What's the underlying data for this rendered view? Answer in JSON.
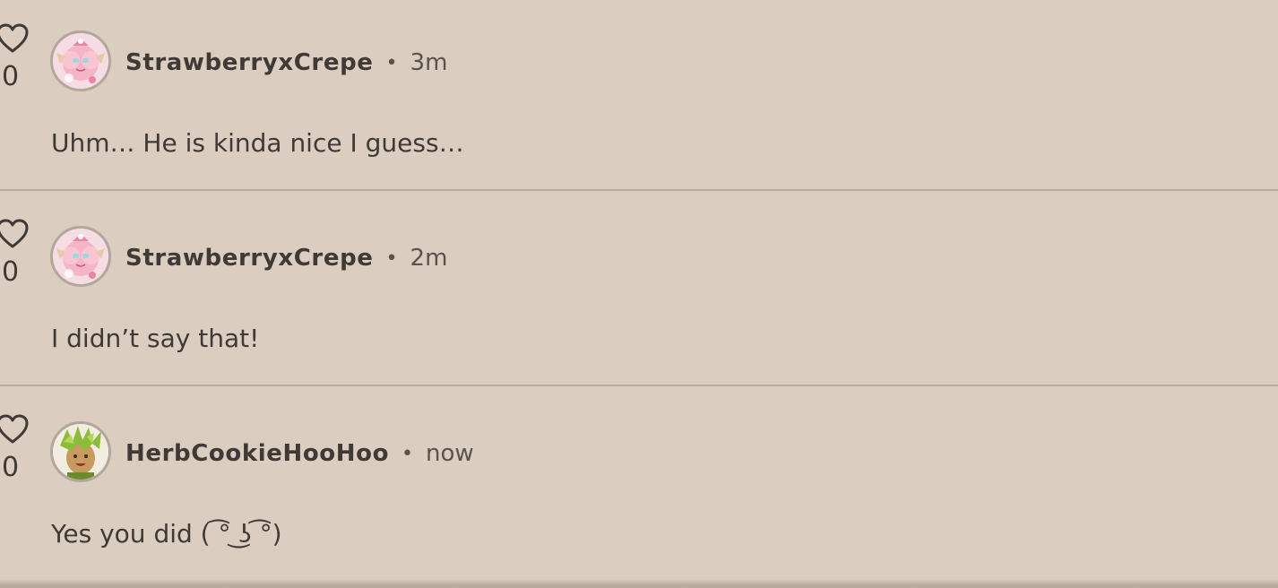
{
  "comments": [
    {
      "likes": "0",
      "username": "StrawberryxCrepe",
      "separator": "•",
      "time": "3m",
      "text": "Uhm… He is kinda nice I guess…",
      "avatar": "strawberry-avatar"
    },
    {
      "likes": "0",
      "username": "StrawberryxCrepe",
      "separator": "•",
      "time": "2m",
      "text": "I didn’t say that!",
      "avatar": "strawberry-avatar"
    },
    {
      "likes": "0",
      "username": "HerbCookieHooHoo",
      "separator": "•",
      "time": "now",
      "text": "Yes you did ( ͡° ͜ʖ ͡°)",
      "avatar": "herb-avatar"
    }
  ],
  "colors": {
    "background": "#dbcdc0",
    "text": "#3f3a36",
    "divider": "#b8aca2"
  }
}
